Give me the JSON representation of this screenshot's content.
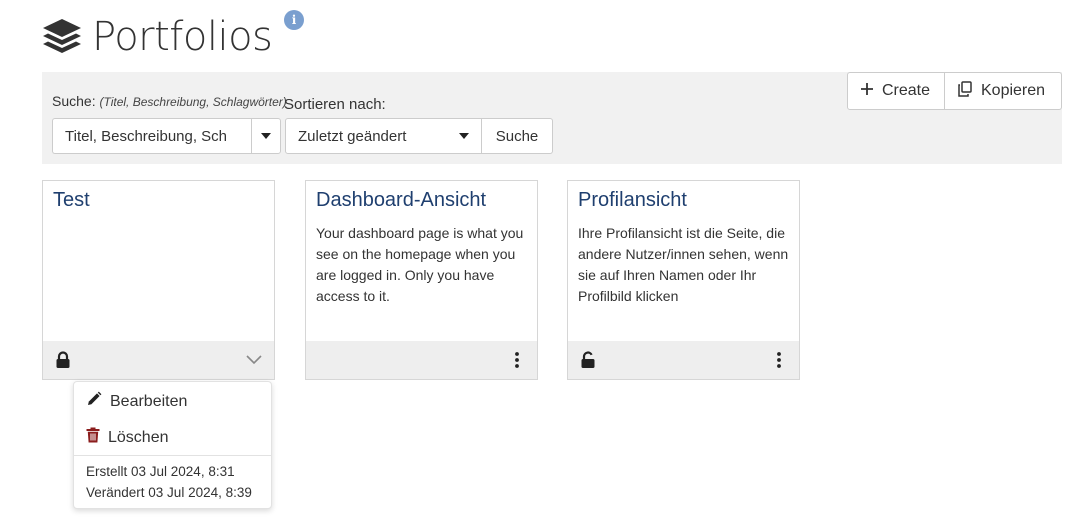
{
  "header": {
    "title": "Portfolios",
    "icon": "layers-icon",
    "info_icon": "info-icon",
    "info_glyph": "i"
  },
  "search": {
    "label": "Suche: ",
    "hint": "(Titel, Beschreibung, Schlagwörter)",
    "input_value": "Titel, Beschreibung, Sch",
    "sort_label": "Sortieren nach:",
    "sort_value": "Zuletzt geändert",
    "search_button": "Suche"
  },
  "actions": {
    "create_label": "Create",
    "copy_label": "Kopieren"
  },
  "cards": [
    {
      "title": "Test",
      "description": "",
      "lock": "locked",
      "menu": "chevron-down"
    },
    {
      "title": "Dashboard-Ansicht",
      "description": "Your dashboard page is what you see on the homepage when you are logged in. Only you have access to it.",
      "menu": "kebab"
    },
    {
      "title": "Profilansicht",
      "description": "Ihre Profilansicht ist die Seite, die andere Nutzer/innen sehen, wenn sie auf Ihren Namen oder Ihr Profilbild klicken",
      "lock": "unlocked",
      "menu": "kebab"
    }
  ],
  "dropdown": {
    "edit_label": "Bearbeiten",
    "delete_label": "Löschen",
    "created": "Erstellt 03 Jul 2024, 8:31",
    "modified": "Verändert 03 Jul 2024, 8:39"
  },
  "colors": {
    "card_title": "#1f3f6f",
    "delete_icon": "#8b1d1d",
    "info_badge": "#7a9fcf",
    "panel_bg": "#f1f1f1"
  }
}
